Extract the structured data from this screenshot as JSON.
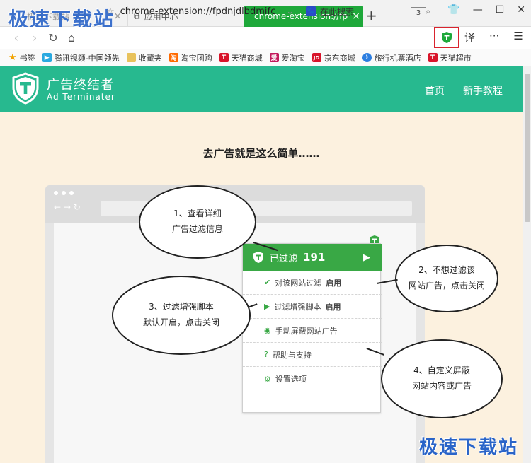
{
  "watermark": "极速下载站",
  "tabs": [
    {
      "label": "极速下载站 首页"
    },
    {
      "label": "应用中心"
    },
    {
      "label": "chrome-extension://fp"
    }
  ],
  "tab_count": "3",
  "address": {
    "url": "chrome-extension://fpdnjdlbdmifc",
    "search_placeholder": "在此搜索"
  },
  "toolbar": {
    "translate": "译",
    "more": "···"
  },
  "bookmarks": [
    {
      "label": "书签",
      "color": "#f2a300"
    },
    {
      "label": "腾讯视频-中国领先",
      "color": "#2aa9e0"
    },
    {
      "label": "收藏夹",
      "color": "#e8c25c"
    },
    {
      "label": "淘宝团购",
      "color": "#ff6a00"
    },
    {
      "label": "天猫商城",
      "color": "#d8142a"
    },
    {
      "label": "爱淘宝",
      "color": "#c2185b"
    },
    {
      "label": "京东商城",
      "color": "#d8142a"
    },
    {
      "label": "旅行机票酒店",
      "color": "#2b7de0"
    },
    {
      "label": "天猫超市",
      "color": "#d8142a"
    }
  ],
  "site": {
    "brand_cn": "广告终结者",
    "brand_en": "Ad Terminater",
    "nav": [
      "首页",
      "新手教程"
    ],
    "headline": "去广告就是这么简单……"
  },
  "popup": {
    "filtered_label": "已过滤",
    "filtered_count": "191",
    "items": [
      {
        "text": "对该网站过滤",
        "bold": "启用"
      },
      {
        "text": "过滤增强脚本",
        "bold": "启用"
      },
      {
        "text": "手动屏蔽网站广告",
        "bold": ""
      },
      {
        "text": "帮助与支持",
        "bold": ""
      },
      {
        "text": "设置选项",
        "bold": ""
      }
    ]
  },
  "callouts": [
    {
      "line1": "1、查看详细",
      "line2": "广告过滤信息"
    },
    {
      "line1": "2、不想过滤该",
      "line2": "网站广告，点击关闭"
    },
    {
      "line1": "3、过滤增强脚本",
      "line2": "默认开启，点击关闭"
    },
    {
      "line1": "4、自定义屏蔽",
      "line2": "网站内容或广告"
    }
  ],
  "colors": {
    "header": "#27b98f",
    "accent": "#39a845",
    "page_bg": "#fcf1df",
    "highlight": "#d9242e"
  }
}
